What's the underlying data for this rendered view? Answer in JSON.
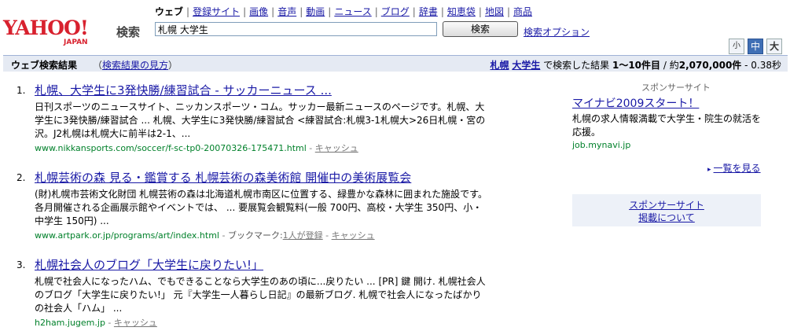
{
  "header": {
    "logo_main": "YAHOO!",
    "logo_sub": "JAPAN",
    "search_label": "検索",
    "tabs": [
      {
        "label": "ウェブ",
        "active": true
      },
      {
        "label": "登録サイト"
      },
      {
        "label": "画像"
      },
      {
        "label": "音声"
      },
      {
        "label": "動画"
      },
      {
        "label": "ニュース"
      },
      {
        "label": "ブログ"
      },
      {
        "label": "辞書"
      },
      {
        "label": "知恵袋"
      },
      {
        "label": "地図"
      },
      {
        "label": "商品"
      }
    ],
    "tab_separator": "|",
    "search_value": "札幌 大学生",
    "search_button": "検索",
    "search_options": "検索オプション",
    "size_buttons": {
      "small": "小",
      "medium": "中",
      "large": "大",
      "active": "medium"
    }
  },
  "results_bar": {
    "title": "ウェブ検索結果",
    "help_open": "（",
    "help_link": "検索結果の見方",
    "help_close": "）",
    "summary": {
      "kw1": "札幌",
      "kw2": "大学生",
      "mid": " で検索した結果 ",
      "range": "1〜10件目",
      "sep": " / 約",
      "total": "2,070,000件",
      "time": " - 0.38秒"
    }
  },
  "results": [
    {
      "number": "1.",
      "title": "札幌、大学生に3発快勝/練習試合 - サッカーニュース ...",
      "snippet": "日刊スポーツのニュースサイト、ニッカンスポーツ・コム。サッカー最新ニュースのページです。札幌、大学生に3発快勝/練習試合 ... 札幌、大学生に3発快勝/練習試合 <練習試合:札幌3-1札幌大>26日札幌・宮の沢。J2札幌は札幌大に前半は2-1、...",
      "url": "www.nikkansports.com/soccer/f-sc-tp0-20070326-175471.html",
      "dash": " - ",
      "cache": "キャッシュ"
    },
    {
      "number": "2.",
      "title": "札幌芸術の森 見る・鑑賞する 札幌芸術の森美術館 開催中の美術展覧会",
      "snippet": "(財)札幌市芸術文化財団 札幌芸術の森は北海道札幌市南区に位置する、緑豊かな森林に囲まれた施設です。各月開催される企画展示館やイベントでは、 ... 要展覧会観覧料(一般 700円、高校・大学生 350円、小・中学生 150円) ...",
      "url": "www.artpark.or.jp/programs/art/index.html",
      "dash": " - ",
      "bookmark_label": "ブックマーク:",
      "bookmark_count": "1人が登録",
      "dash2": " - ",
      "cache": "キャッシュ"
    },
    {
      "number": "3.",
      "title": "札幌社会人のブログ「大学生に戻りたい!」",
      "snippet": "札幌で社会人になったハム、でもできることなら大学生のあの頃に...戻りたい ... [PR] 鍵 開け. 札幌社会人のブログ「大学生に戻りたい!」 元『大学生一人暮らし日記』の最新ブログ. 札幌で社会人になったばかりの社会人「ハム」 ...",
      "url": "h2ham.jugem.jp",
      "dash": " - ",
      "cache": "キャッシュ"
    }
  ],
  "sponsor": {
    "label": "スポンサーサイト",
    "ad_title": "マイナビ2009スタート！",
    "ad_text": "札幌の求人情報満載で大学生・院生の就活を応援。",
    "ad_url": "job.mynavi.jp",
    "more": "一覧を見る",
    "box_line1": "スポンサーサイト",
    "box_line2": "掲載について"
  }
}
